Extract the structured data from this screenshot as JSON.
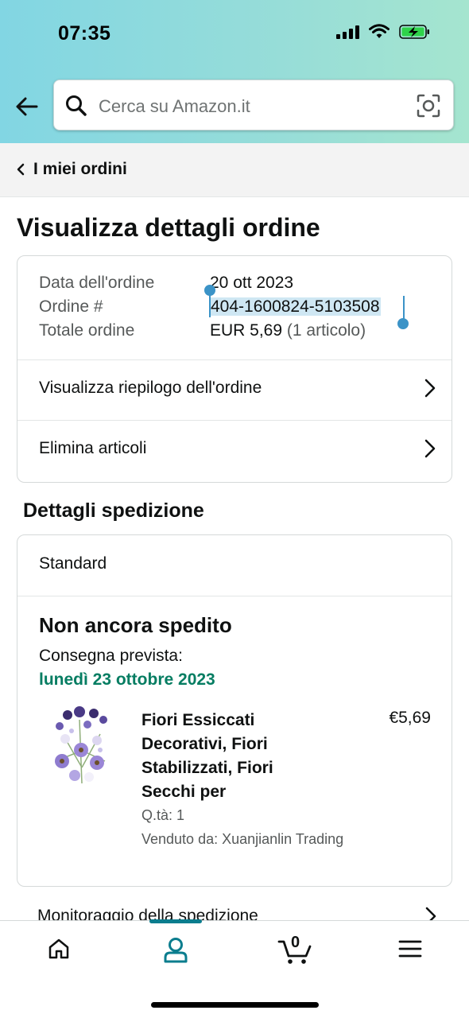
{
  "status_bar": {
    "time": "07:35"
  },
  "search": {
    "placeholder": "Cerca su Amazon.it"
  },
  "breadcrumb": {
    "label": "I miei ordini"
  },
  "page_title": "Visualizza dettagli ordine",
  "order_info": {
    "date_label": "Data dell'ordine",
    "date_value": "20 ott 2023",
    "number_label": "Ordine #",
    "number_value": "404-1600824-5103508",
    "total_label": "Totale ordine",
    "total_value": "EUR 5,69",
    "total_items": "(1 articolo)"
  },
  "order_links": {
    "summary": "Visualizza riepilogo dell'ordine",
    "delete_items": "Elimina articoli"
  },
  "shipping": {
    "section_title": "Dettagli spedizione",
    "method": "Standard",
    "status": "Non ancora spedito",
    "delivery_label": "Consegna prevista:",
    "delivery_date": "lunedì 23 ottobre 2023",
    "tracking": "Monitoraggio della spedizione"
  },
  "product": {
    "title": "Fiori Essiccati Decorativi, Fiori Stabilizzati, Fiori Secchi per",
    "price": "€5,69",
    "quantity": "Q.tà: 1",
    "seller": "Venduto da: Xuanjianlin Trading"
  },
  "bottom_nav": {
    "items": [
      "home-icon",
      "account-icon",
      "cart-icon",
      "menu-icon"
    ],
    "cart_count": "0",
    "active": "account-icon"
  },
  "colors": {
    "accent_teal": "#0b7d8e",
    "delivery_green": "#067d62",
    "selection_blue": "#3b93c7"
  }
}
